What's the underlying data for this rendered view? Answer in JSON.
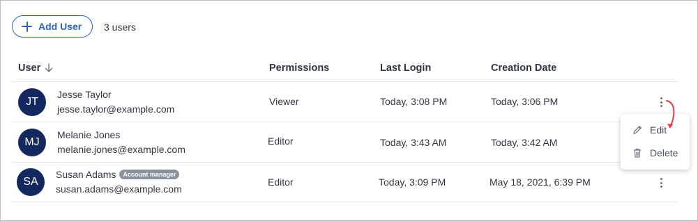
{
  "toolbar": {
    "add_user_label": "Add User",
    "user_count": "3 users"
  },
  "table": {
    "headers": {
      "user": "User",
      "permissions": "Permissions",
      "last_login": "Last Login",
      "creation_date": "Creation Date"
    },
    "rows": [
      {
        "initials": "JT",
        "name": "Jesse Taylor",
        "email": "jesse.taylor@example.com",
        "badge": "",
        "permissions": "Viewer",
        "last_login": "Today, 3:08 PM",
        "creation_date": "Today, 3:06 PM"
      },
      {
        "initials": "MJ",
        "name": "Melanie Jones",
        "email": "melanie.jones@example.com",
        "badge": "",
        "permissions": "Editor",
        "last_login": "Today, 3:43 AM",
        "creation_date": "Today, 3:42 AM"
      },
      {
        "initials": "SA",
        "name": "Susan Adams",
        "email": "susan.adams@example.com",
        "badge": "Account manager",
        "permissions": "Editor",
        "last_login": "Today, 3:09 PM",
        "creation_date": "May 18, 2021, 6:39 PM"
      }
    ]
  },
  "context_menu": {
    "edit_label": "Edit",
    "delete_label": "Delete"
  },
  "icons": {
    "add": "plus-icon",
    "sort": "arrow-down-icon",
    "row_menu": "more-vertical-icon",
    "edit": "pencil-icon",
    "delete": "trash-icon"
  },
  "colors": {
    "accent": "#2f65b8",
    "avatar_bg": "#13285e",
    "badge_bg": "#8a929c",
    "annotation_arrow": "#e53945"
  }
}
